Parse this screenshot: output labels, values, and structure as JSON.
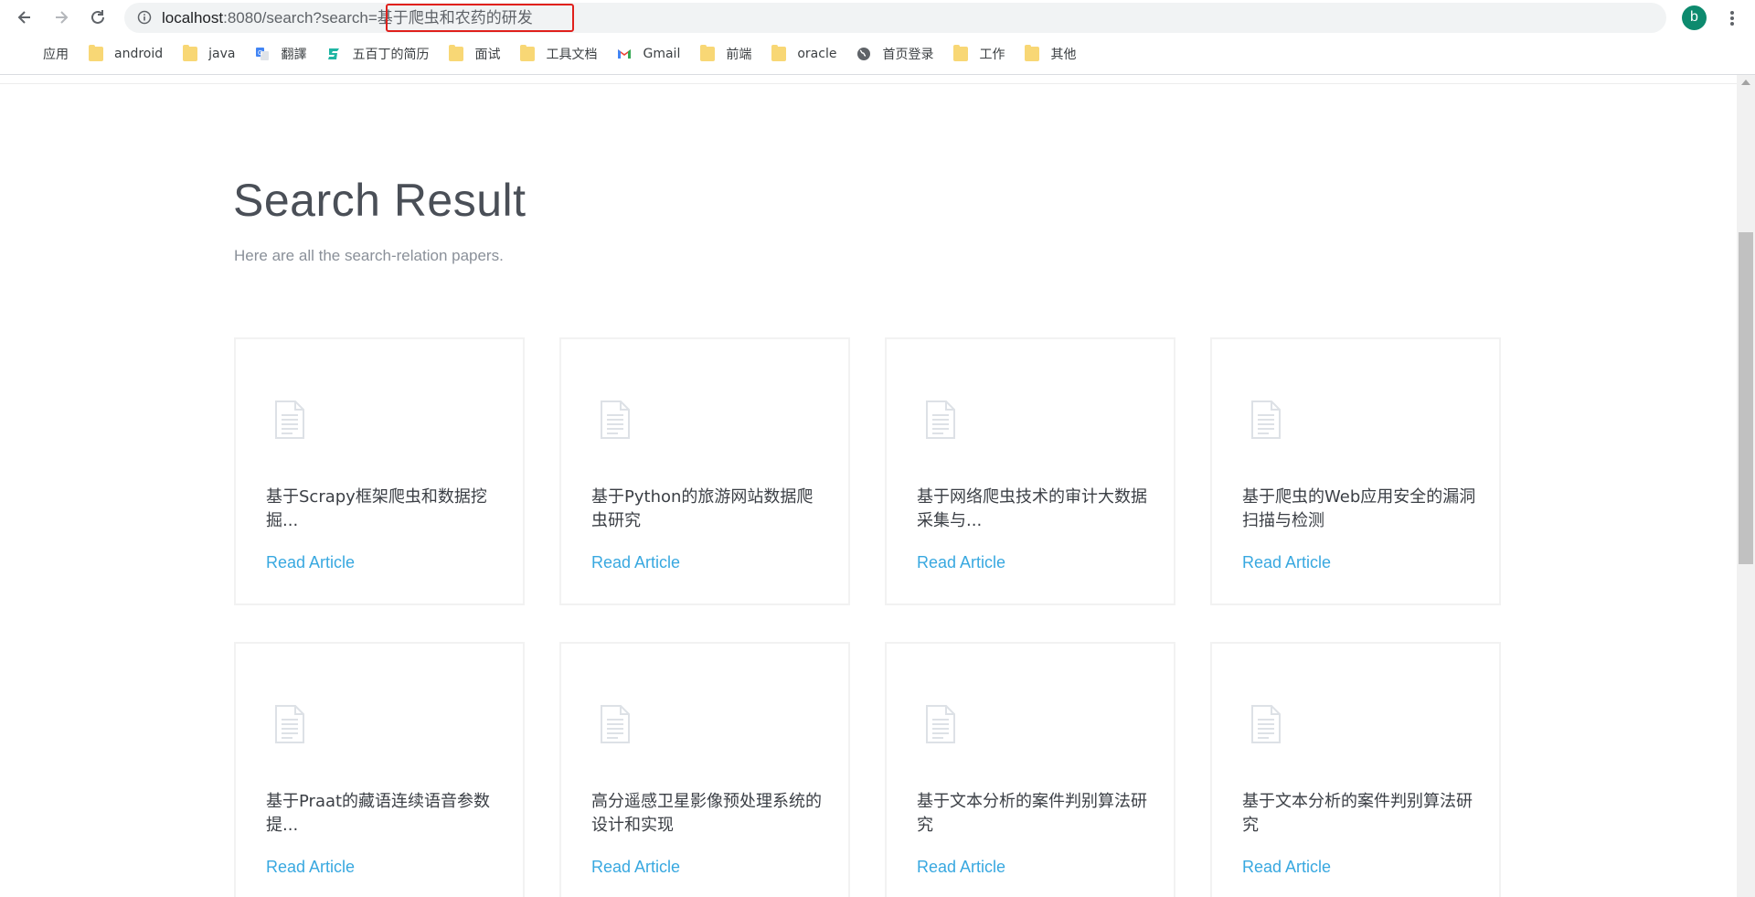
{
  "browser": {
    "url_host": "localhost",
    "url_path": ":8080/search?search=基于爬虫和农药的研发",
    "profile_initial": "b",
    "bookmarks": [
      {
        "label": "应用",
        "icon": "apps-grid-icon"
      },
      {
        "label": "android",
        "icon": "folder-icon"
      },
      {
        "label": "java",
        "icon": "folder-icon"
      },
      {
        "label": "翻譯",
        "icon": "translate-icon"
      },
      {
        "label": "五百丁的简历",
        "icon": "resume-site-icon"
      },
      {
        "label": "面试",
        "icon": "folder-icon"
      },
      {
        "label": "工具文档",
        "icon": "folder-icon"
      },
      {
        "label": "Gmail",
        "icon": "gmail-icon"
      },
      {
        "label": "前端",
        "icon": "folder-icon"
      },
      {
        "label": "oracle",
        "icon": "folder-icon"
      },
      {
        "label": "首页登录",
        "icon": "globe-icon"
      },
      {
        "label": "工作",
        "icon": "folder-icon"
      },
      {
        "label": "其他",
        "icon": "folder-icon"
      }
    ]
  },
  "page": {
    "title": "Search Result",
    "subtitle": "Here are all the search-relation papers.",
    "link_label": "Read Article",
    "cards": [
      {
        "title": "基于Scrapy框架爬虫和数据挖掘..."
      },
      {
        "title": "基于Python的旅游网站数据爬虫研究"
      },
      {
        "title": "基于网络爬虫技术的审计大数据采集与..."
      },
      {
        "title": "基于爬虫的Web应用安全的漏洞扫描与检测"
      },
      {
        "title": "基于Praat的藏语连续语音参数提..."
      },
      {
        "title": "高分遥感卫星影像预处理系统的设计和实现"
      },
      {
        "title": "基于文本分析的案件判别算法研究"
      },
      {
        "title": "基于文本分析的案件判别算法研究"
      }
    ]
  },
  "colors": {
    "link": "#38a8e0",
    "highlight_box": "#e0201c",
    "avatar": "#0d8a6e",
    "folder": "#f8d775"
  }
}
